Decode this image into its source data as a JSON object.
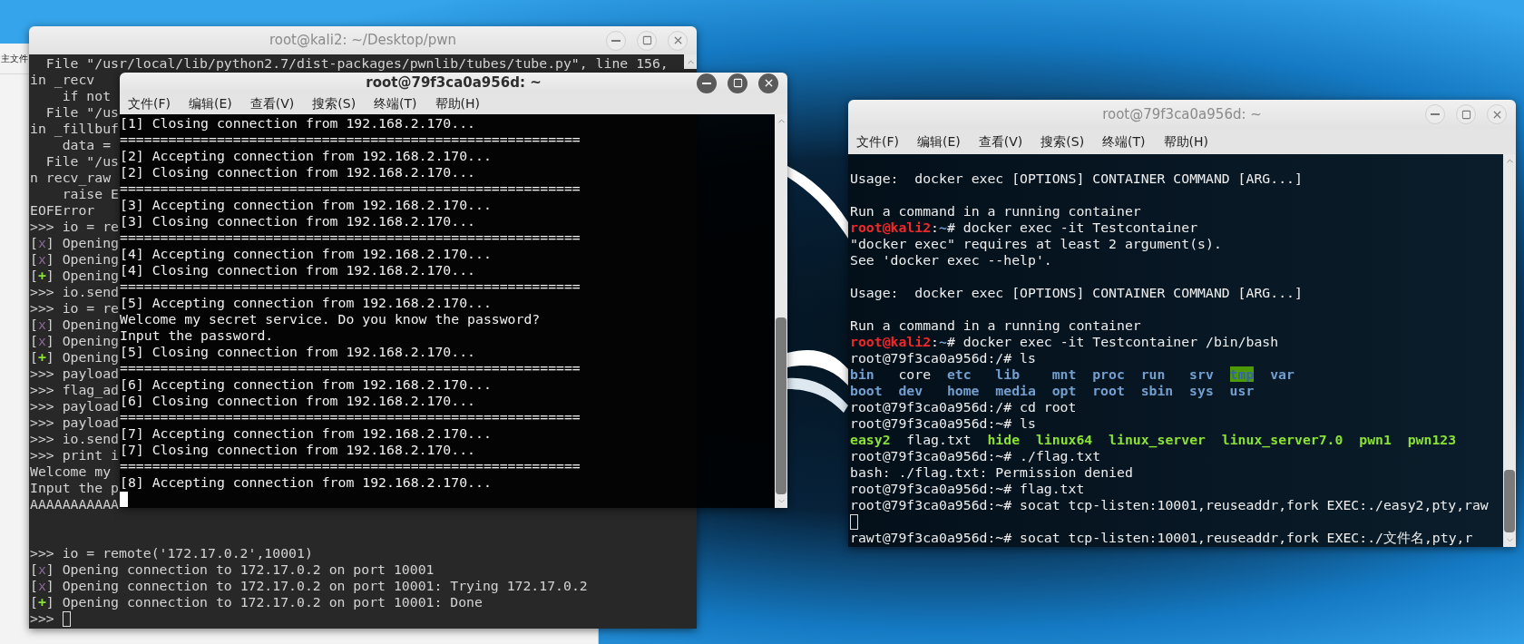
{
  "file_manager": {
    "label": "主文件"
  },
  "windows": [
    {
      "title": "root@kali2: ~/Desktop/pwn",
      "active": false,
      "lines": [
        {
          "kind": "text",
          "text": "  File \"/usr/local/lib/python2.7/dist-packages/pwnlib/tubes/tube.py\", line 156,"
        },
        {
          "kind": "text",
          "text": "in _recv"
        },
        {
          "kind": "text",
          "text": "    if not"
        },
        {
          "kind": "text",
          "text": "  File \"/us"
        },
        {
          "kind": "text",
          "text": "in _fillbuf"
        },
        {
          "kind": "text",
          "text": "    data ="
        },
        {
          "kind": "text",
          "text": "  File \"/us"
        },
        {
          "kind": "text",
          "text": "n recv_raw"
        },
        {
          "kind": "text",
          "text": "    raise E"
        },
        {
          "kind": "text",
          "text": "EOFError"
        },
        {
          "kind": "text",
          "text": ">>> io = re"
        },
        {
          "kind": "segments",
          "segments": [
            {
              "text": "[",
              "kind": "plain"
            },
            {
              "text": "x",
              "kind": "tag_x"
            },
            {
              "text": "] Opening",
              "kind": "plain"
            }
          ]
        },
        {
          "kind": "segments",
          "segments": [
            {
              "text": "[",
              "kind": "plain"
            },
            {
              "text": "x",
              "kind": "tag_x"
            },
            {
              "text": "] Opening",
              "kind": "plain"
            }
          ]
        },
        {
          "kind": "segments",
          "segments": [
            {
              "text": "[",
              "kind": "plain"
            },
            {
              "text": "+",
              "kind": "tag_plus"
            },
            {
              "text": "] Opening",
              "kind": "plain"
            }
          ]
        },
        {
          "kind": "text",
          "text": ">>> io.send"
        },
        {
          "kind": "text",
          "text": ">>> io = re"
        },
        {
          "kind": "segments",
          "segments": [
            {
              "text": "[",
              "kind": "plain"
            },
            {
              "text": "x",
              "kind": "tag_x"
            },
            {
              "text": "] Opening",
              "kind": "plain"
            }
          ]
        },
        {
          "kind": "segments",
          "segments": [
            {
              "text": "[",
              "kind": "plain"
            },
            {
              "text": "x",
              "kind": "tag_x"
            },
            {
              "text": "] Opening",
              "kind": "plain"
            }
          ]
        },
        {
          "kind": "segments",
          "segments": [
            {
              "text": "[",
              "kind": "plain"
            },
            {
              "text": "+",
              "kind": "tag_plus"
            },
            {
              "text": "] Opening",
              "kind": "plain"
            }
          ]
        },
        {
          "kind": "text",
          "text": ">>> payload"
        },
        {
          "kind": "text",
          "text": ">>> flag_ad"
        },
        {
          "kind": "text",
          "text": ">>> payload"
        },
        {
          "kind": "text",
          "text": ">>> payload"
        },
        {
          "kind": "text",
          "text": ">>> io.send"
        },
        {
          "kind": "text",
          "text": ">>> print i"
        },
        {
          "kind": "text",
          "text": "Welcome my"
        },
        {
          "kind": "text",
          "text": "Input the p"
        },
        {
          "kind": "text",
          "text": "AAAAAAAAAAA"
        },
        {
          "kind": "blank"
        },
        {
          "kind": "blank"
        },
        {
          "kind": "text",
          "text": ">>> io = remote('172.17.0.2',10001)"
        },
        {
          "kind": "segments",
          "segments": [
            {
              "text": "[",
              "kind": "plain"
            },
            {
              "text": "x",
              "kind": "tag_x"
            },
            {
              "text": "] Opening connection to 172.17.0.2 on port 10001",
              "kind": "plain"
            }
          ]
        },
        {
          "kind": "segments",
          "segments": [
            {
              "text": "[",
              "kind": "plain"
            },
            {
              "text": "x",
              "kind": "tag_x"
            },
            {
              "text": "] Opening connection to 172.17.0.2 on port 10001: Trying 172.17.0.2",
              "kind": "plain"
            }
          ]
        },
        {
          "kind": "segments",
          "segments": [
            {
              "text": "[",
              "kind": "plain"
            },
            {
              "text": "+",
              "kind": "tag_plus"
            },
            {
              "text": "] Opening connection to 172.17.0.2 on port 10001: Done",
              "kind": "plain"
            }
          ]
        },
        {
          "kind": "cursor",
          "text": ">>>"
        }
      ]
    },
    {
      "title": "root@79f3ca0a956d: ~",
      "active": true,
      "menu": [
        "文件(F)",
        "编辑(E)",
        "查看(V)",
        "搜索(S)",
        "终端(T)",
        "帮助(H)"
      ],
      "lines": [
        {
          "kind": "text",
          "text": "[1] Closing connection from 192.168.2.170..."
        },
        {
          "kind": "text",
          "text": "========================================================="
        },
        {
          "kind": "text",
          "text": "[2] Accepting connection from 192.168.2.170..."
        },
        {
          "kind": "text",
          "text": "[2] Closing connection from 192.168.2.170..."
        },
        {
          "kind": "text",
          "text": "========================================================="
        },
        {
          "kind": "text",
          "text": "[3] Accepting connection from 192.168.2.170..."
        },
        {
          "kind": "text",
          "text": "[3] Closing connection from 192.168.2.170..."
        },
        {
          "kind": "text",
          "text": "========================================================="
        },
        {
          "kind": "text",
          "text": "[4] Accepting connection from 192.168.2.170..."
        },
        {
          "kind": "text",
          "text": "[4] Closing connection from 192.168.2.170..."
        },
        {
          "kind": "text",
          "text": "========================================================="
        },
        {
          "kind": "text",
          "text": "[5] Accepting connection from 192.168.2.170..."
        },
        {
          "kind": "text",
          "text": "Welcome my secret service. Do you know the password?"
        },
        {
          "kind": "text",
          "text": "Input the password."
        },
        {
          "kind": "text",
          "text": "[5] Closing connection from 192.168.2.170..."
        },
        {
          "kind": "text",
          "text": "========================================================="
        },
        {
          "kind": "text",
          "text": "[6] Accepting connection from 192.168.2.170..."
        },
        {
          "kind": "text",
          "text": "[6] Closing connection from 192.168.2.170..."
        },
        {
          "kind": "text",
          "text": "========================================================="
        },
        {
          "kind": "text",
          "text": "[7] Accepting connection from 192.168.2.170..."
        },
        {
          "kind": "text",
          "text": "[7] Closing connection from 192.168.2.170..."
        },
        {
          "kind": "text",
          "text": "========================================================="
        },
        {
          "kind": "text",
          "text": "[8] Accepting connection from 192.168.2.170..."
        },
        {
          "kind": "cursor"
        }
      ]
    },
    {
      "title": "root@79f3ca0a956d: ~",
      "active": false,
      "menu": [
        "文件(F)",
        "编辑(E)",
        "查看(V)",
        "搜索(S)",
        "终端(T)",
        "帮助(H)"
      ],
      "lines": [
        {
          "kind": "blank"
        },
        {
          "kind": "text",
          "text": "Usage:  docker exec [OPTIONS] CONTAINER COMMAND [ARG...]"
        },
        {
          "kind": "blank"
        },
        {
          "kind": "text",
          "text": "Run a command in a running container"
        },
        {
          "kind": "segments",
          "segments": [
            {
              "text": "root@kali2",
              "kind": "red"
            },
            {
              "text": ":",
              "kind": "plain"
            },
            {
              "text": "~",
              "kind": "blue"
            },
            {
              "text": "# docker exec -it Testcontainer",
              "kind": "plain"
            }
          ]
        },
        {
          "kind": "text",
          "text": "\"docker exec\" requires at least 2 argument(s)."
        },
        {
          "kind": "text",
          "text": "See 'docker exec --help'."
        },
        {
          "kind": "blank"
        },
        {
          "kind": "text",
          "text": "Usage:  docker exec [OPTIONS] CONTAINER COMMAND [ARG...]"
        },
        {
          "kind": "blank"
        },
        {
          "kind": "text",
          "text": "Run a command in a running container"
        },
        {
          "kind": "segments",
          "segments": [
            {
              "text": "root@kali2",
              "kind": "red"
            },
            {
              "text": ":",
              "kind": "plain"
            },
            {
              "text": "~",
              "kind": "blue"
            },
            {
              "text": "# docker exec -it Testcontainer /bin/bash",
              "kind": "plain"
            }
          ]
        },
        {
          "kind": "text",
          "text": "root@79f3ca0a956d:/# ls"
        },
        {
          "kind": "ls_grid",
          "items": [
            {
              "text": "bin",
              "kind": "dir"
            },
            {
              "text": "core",
              "kind": "plain"
            },
            {
              "text": "etc",
              "kind": "dir"
            },
            {
              "text": "lib",
              "kind": "dir"
            },
            {
              "text": "mnt",
              "kind": "dir"
            },
            {
              "text": "proc",
              "kind": "dir"
            },
            {
              "text": "run",
              "kind": "dir"
            },
            {
              "text": "srv",
              "kind": "dir"
            },
            {
              "text": "tmp",
              "kind": "sticky"
            },
            {
              "text": "var",
              "kind": "dir"
            }
          ]
        },
        {
          "kind": "ls_grid",
          "items": [
            {
              "text": "boot",
              "kind": "dir"
            },
            {
              "text": "dev",
              "kind": "dir"
            },
            {
              "text": "home",
              "kind": "dir"
            },
            {
              "text": "media",
              "kind": "dir"
            },
            {
              "text": "opt",
              "kind": "dir"
            },
            {
              "text": "root",
              "kind": "dir"
            },
            {
              "text": "sbin",
              "kind": "dir"
            },
            {
              "text": "sys",
              "kind": "dir"
            },
            {
              "text": "usr",
              "kind": "dir"
            }
          ]
        },
        {
          "kind": "text",
          "text": "root@79f3ca0a956d:/# cd root"
        },
        {
          "kind": "text",
          "text": "root@79f3ca0a956d:~# ls"
        },
        {
          "kind": "ls",
          "items": [
            {
              "text": "easy2",
              "kind": "exec"
            },
            {
              "text": "flag.txt",
              "kind": "plain"
            },
            {
              "text": "hide",
              "kind": "exec"
            },
            {
              "text": "linux64",
              "kind": "exec"
            },
            {
              "text": "linux_server",
              "kind": "exec"
            },
            {
              "text": "linux_server7.0",
              "kind": "exec"
            },
            {
              "text": "pwn1",
              "kind": "exec"
            },
            {
              "text": "pwn123",
              "kind": "exec"
            }
          ]
        },
        {
          "kind": "text",
          "text": "root@79f3ca0a956d:~# ./flag.txt"
        },
        {
          "kind": "text",
          "text": "bash: ./flag.txt: Permission denied"
        },
        {
          "kind": "text",
          "text": "root@79f3ca0a956d:~# flag.txt"
        },
        {
          "kind": "text",
          "text": "root@79f3ca0a956d:~# socat tcp-listen:10001,reuseaddr,fork EXEC:./easy2,pty,raw"
        },
        {
          "kind": "cursor"
        },
        {
          "kind": "text",
          "text": "rawt@79f3ca0a956d:~# socat tcp-listen:10001,reuseaddr,fork EXEC:./文件名,pty,r"
        }
      ]
    }
  ]
}
